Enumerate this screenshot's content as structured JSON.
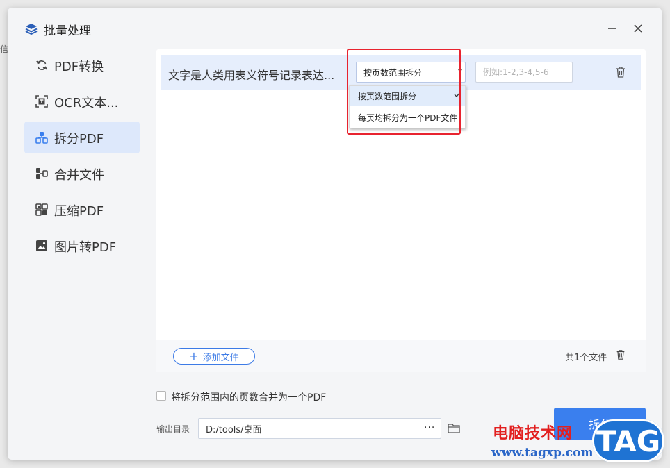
{
  "edge_text": "信",
  "window": {
    "title": "批量处理",
    "icon": "layers-icon",
    "minimize_icon": "minimize-icon",
    "close_icon": "close-icon"
  },
  "sidebar": {
    "items": [
      {
        "label": "PDF转换",
        "icon": "refresh-icon",
        "active": false
      },
      {
        "label": "OCR文本...",
        "icon": "ocr-icon",
        "active": false
      },
      {
        "label": "拆分PDF",
        "icon": "split-icon",
        "active": true
      },
      {
        "label": "合并文件",
        "icon": "merge-icon",
        "active": false
      },
      {
        "label": "压缩PDF",
        "icon": "compress-icon",
        "active": false
      },
      {
        "label": "图片转PDF",
        "icon": "image-icon",
        "active": false
      }
    ]
  },
  "file_list": {
    "rows": [
      {
        "name": "文字是人类用表义符号记录表达...",
        "split_mode": "按页数范围拆分",
        "range_placeholder": "例如:1-2,3-4,5-6"
      }
    ]
  },
  "split_dropdown": {
    "options": [
      "按页数范围拆分",
      "每页均拆分为一个PDF文件"
    ],
    "selected_index": 0
  },
  "footer": {
    "add_label": "添加文件",
    "file_count": "共1个文件"
  },
  "merge_option": {
    "label": "将拆分范围内的页数合并为一个PDF",
    "checked": false
  },
  "output": {
    "label": "输出目录",
    "path": "D:/tools/桌面",
    "more_label": "···"
  },
  "primary_button": {
    "label": "拆分"
  },
  "watermark": {
    "cn": "电脑技术网",
    "url": "www.tagxp.com",
    "badge": "TAG"
  },
  "colors": {
    "accent": "#3a7fee",
    "highlight": "#e8232f",
    "active_nav": "#dde8fb"
  }
}
